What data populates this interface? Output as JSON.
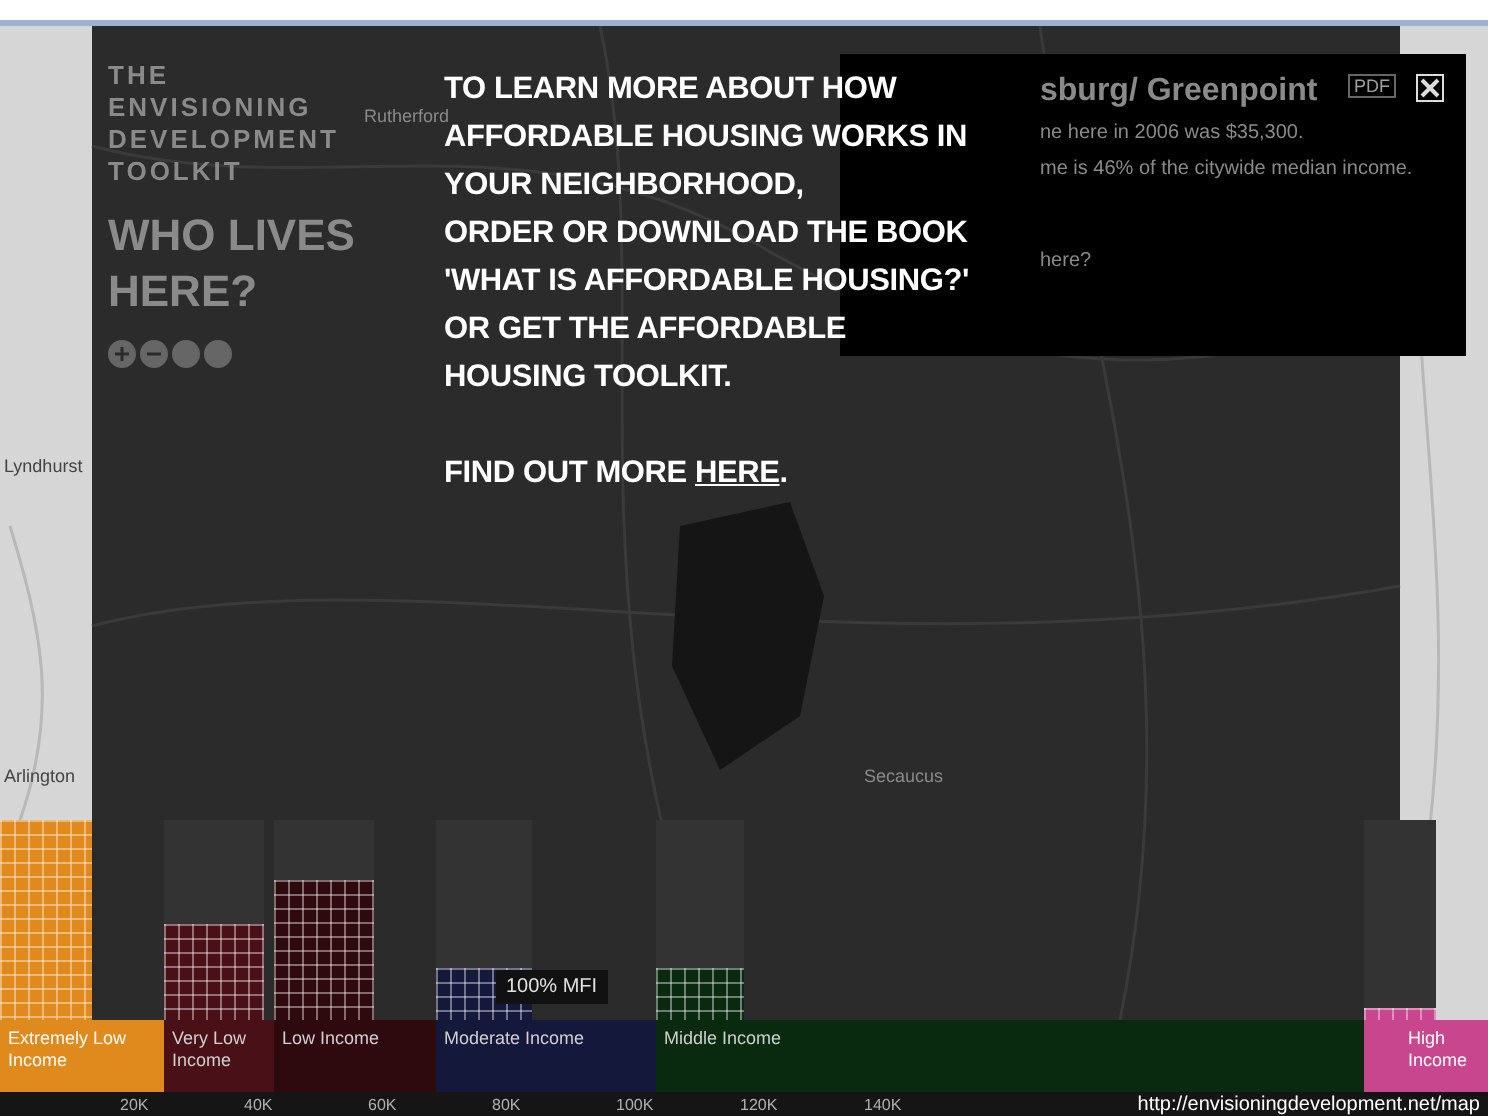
{
  "header": {
    "toolkit_title": "THE ENVISIONING DEVELOPMENT TOOLKIT",
    "heading": "WHO LIVES HERE?"
  },
  "map_labels": [
    {
      "text": "Rutherford"
    },
    {
      "text": "Lyndhurst"
    },
    {
      "text": "Arlington"
    },
    {
      "text": "Secaucus"
    }
  ],
  "info_panel": {
    "title": "sburg/ Greenpoint",
    "lines": [
      "ne here in 2006 was $35,300.",
      "me is 46% of the citywide median income.",
      "here?"
    ],
    "pdf_button": "PDF"
  },
  "income_bands": [
    {
      "label": "Extremely Low Income",
      "color": "#e0891c",
      "level": 1.0
    },
    {
      "label": "Very Low Income",
      "color": "#4a1018",
      "level": 0.48
    },
    {
      "label": "Low Income",
      "color": "#2e0a0e",
      "level": 0.7
    },
    {
      "label": "Moderate Income",
      "color": "#14183a",
      "level": 0.26
    },
    {
      "label": "Middle Income",
      "color": "#0a2a10",
      "level": 0.26
    },
    {
      "label": "High Income",
      "color": "#c8468e",
      "level": 0.06
    }
  ],
  "axis_ticks": [
    "20K",
    "40K",
    "60K",
    "80K",
    "100K",
    "120K",
    "140K"
  ],
  "mfi_label": "100% MFI",
  "message": {
    "lines": [
      "TO LEARN MORE ABOUT HOW",
      "AFFORDABLE HOUSING WORKS IN",
      "YOUR NEIGHBORHOOD,",
      "ORDER OR DOWNLOAD THE BOOK",
      "'WHAT IS AFFORDABLE HOUSING?'",
      "OR GET THE AFFORDABLE",
      "HOUSING TOOLKIT."
    ],
    "link_prefix": "FIND OUT MORE ",
    "link": "HERE",
    "link_suffix": "."
  },
  "url": "http://envisioningdevelopment.net/map"
}
